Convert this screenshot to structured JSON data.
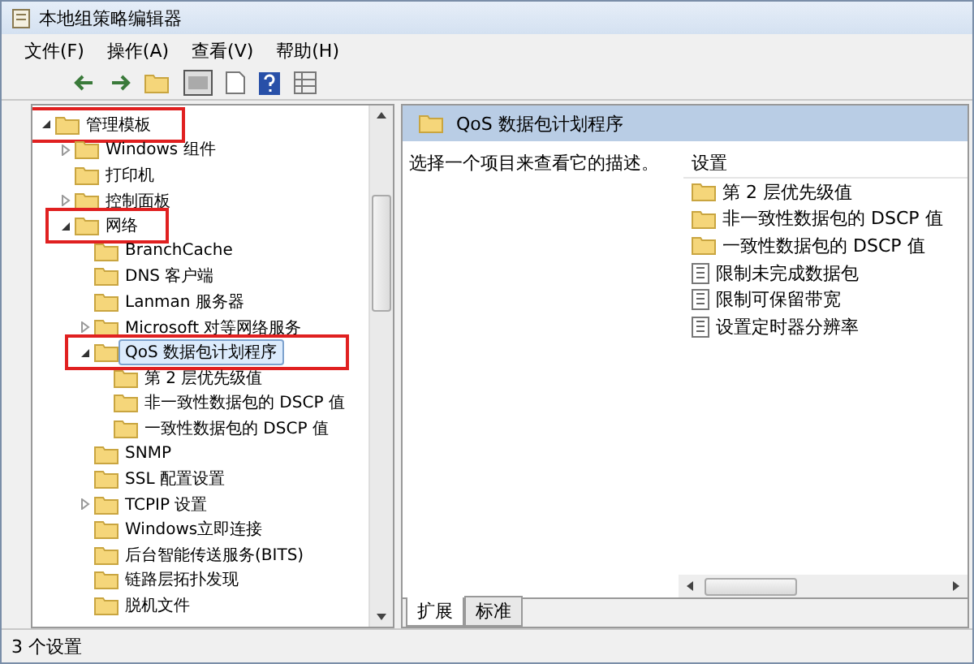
{
  "window": {
    "title": "本地组策略编辑器"
  },
  "menu": [
    {
      "label": "文件(F)"
    },
    {
      "label": "操作(A)"
    },
    {
      "label": "查看(V)"
    },
    {
      "label": "帮助(H)"
    }
  ],
  "tree": [
    {
      "label": "管理模板",
      "expanded": true,
      "selected": false,
      "highlighted": true,
      "children": [
        {
          "label": "Windows 组件",
          "expanded": false,
          "selected": false,
          "highlighted": false
        },
        {
          "label": "打印机",
          "selected": false,
          "highlighted": false
        },
        {
          "label": "控制面板",
          "expanded": false,
          "selected": false,
          "highlighted": false
        },
        {
          "label": "网络",
          "expanded": true,
          "selected": false,
          "highlighted": true,
          "children": [
            {
              "label": "BranchCache",
              "selected": false,
              "highlighted": false
            },
            {
              "label": "DNS 客户端",
              "selected": false,
              "highlighted": false
            },
            {
              "label": "Lanman 服务器",
              "selected": false,
              "highlighted": false
            },
            {
              "label": "Microsoft 对等网络服务",
              "expanded": false,
              "selected": false,
              "highlighted": false
            },
            {
              "label": "QoS 数据包计划程序",
              "expanded": true,
              "selected": true,
              "highlighted": true,
              "children": [
                {
                  "label": "第 2 层优先级值",
                  "selected": false,
                  "highlighted": false
                },
                {
                  "label": "非一致性数据包的 DSCP 值",
                  "selected": false,
                  "highlighted": false
                },
                {
                  "label": "一致性数据包的 DSCP 值",
                  "selected": false,
                  "highlighted": false
                }
              ]
            },
            {
              "label": "SNMP",
              "selected": false,
              "highlighted": false
            },
            {
              "label": "SSL 配置设置",
              "selected": false,
              "highlighted": false
            },
            {
              "label": "TCPIP 设置",
              "expanded": false,
              "selected": false,
              "highlighted": false
            },
            {
              "label": "Windows立即连接",
              "selected": false,
              "highlighted": false
            },
            {
              "label": "后台智能传送服务(BITS)",
              "selected": false,
              "highlighted": false
            },
            {
              "label": "链路层拓扑发现",
              "selected": false,
              "highlighted": false
            },
            {
              "label": "脱机文件",
              "selected": false,
              "highlighted": false
            }
          ]
        }
      ]
    }
  ],
  "details": {
    "title": "QoS 数据包计划程序",
    "description": "选择一个项目来查看它的描述。",
    "column": "设置",
    "items": [
      {
        "kind": "folder",
        "label": "第 2 层优先级值"
      },
      {
        "kind": "folder",
        "label": "非一致性数据包的 DSCP 值"
      },
      {
        "kind": "folder",
        "label": "一致性数据包的 DSCP 值"
      },
      {
        "kind": "setting",
        "label": "限制未完成数据包"
      },
      {
        "kind": "setting",
        "label": "限制可保留带宽"
      },
      {
        "kind": "setting",
        "label": "设置定时器分辨率"
      }
    ]
  },
  "view_tabs": [
    {
      "label": "扩展",
      "selected": true
    },
    {
      "label": "标准",
      "selected": false
    }
  ],
  "status_bar": "3 个设置"
}
